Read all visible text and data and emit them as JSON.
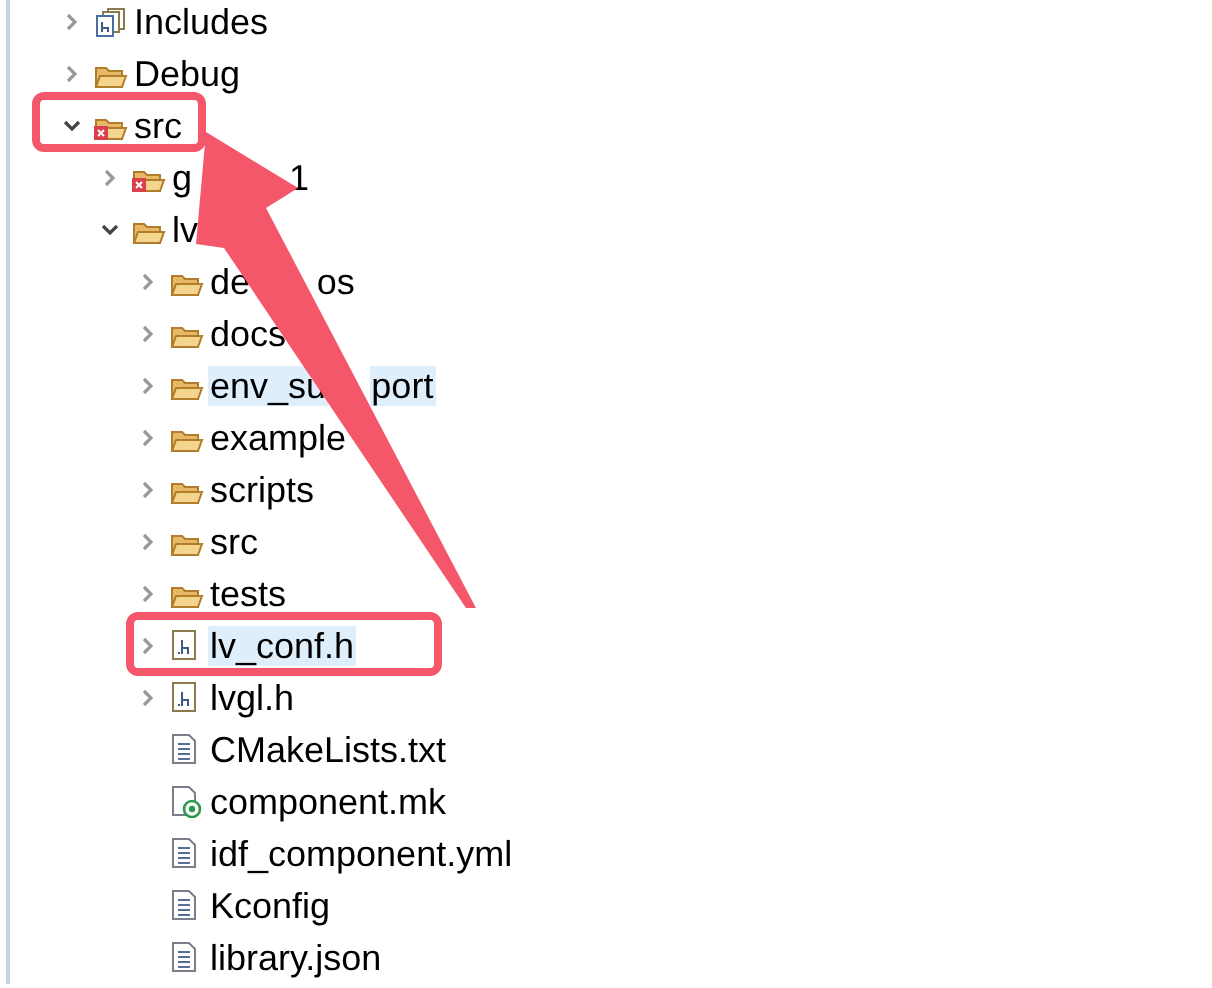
{
  "tree": [
    {
      "label": "Includes",
      "kind": "includes",
      "expanded": false,
      "selected": false
    },
    {
      "label": "Debug",
      "kind": "folder",
      "expanded": false,
      "selected": false
    },
    {
      "label": "src",
      "kind": "source-folder",
      "expanded": true,
      "selected": false,
      "children": [
        {
          "label": "g",
          "tail": "1",
          "kind": "source-folder",
          "expanded": false,
          "selected": false
        },
        {
          "label": "lv",
          "kind": "folder",
          "expanded": true,
          "selected": false,
          "children": [
            {
              "label": "de",
              "tail": "os",
              "kind": "folder",
              "expanded": false,
              "selected": false
            },
            {
              "label": "docs",
              "kind": "folder",
              "expanded": false,
              "selected": false
            },
            {
              "label": "env_su",
              "tail": "port",
              "kind": "folder",
              "expanded": false,
              "selected": true
            },
            {
              "label": "example",
              "kind": "folder",
              "expanded": false,
              "selected": false
            },
            {
              "label": "scripts",
              "kind": "folder",
              "expanded": false,
              "selected": false
            },
            {
              "label": "src",
              "kind": "folder",
              "expanded": false,
              "selected": false
            },
            {
              "label": "tests",
              "kind": "folder",
              "expanded": false,
              "selected": false
            },
            {
              "label": "lv_conf.h",
              "kind": "header",
              "expanded": false,
              "selected": true
            },
            {
              "label": "lvgl.h",
              "kind": "header",
              "expanded": false,
              "selected": false
            },
            {
              "label": "CMakeLists.txt",
              "kind": "text-file",
              "selected": false
            },
            {
              "label": "component.mk",
              "kind": "make-file",
              "selected": false
            },
            {
              "label": "idf_component.yml",
              "kind": "text-file",
              "selected": false
            },
            {
              "label": "Kconfig",
              "kind": "text-file",
              "selected": false
            },
            {
              "label": "library.json",
              "kind": "text-file",
              "selected": false
            }
          ]
        }
      ]
    }
  ]
}
